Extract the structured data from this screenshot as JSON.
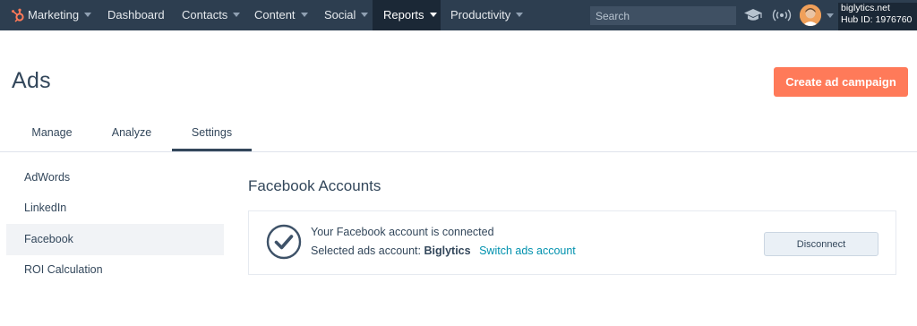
{
  "topnav": {
    "items": [
      {
        "label": "Marketing"
      },
      {
        "label": "Dashboard"
      },
      {
        "label": "Contacts"
      },
      {
        "label": "Content"
      },
      {
        "label": "Social"
      },
      {
        "label": "Reports"
      },
      {
        "label": "Productivity"
      }
    ],
    "active": "Reports",
    "search_placeholder": "Search",
    "account_domain": "biglytics.net",
    "hub_id": "Hub ID: 1976760",
    "icons": [
      "hubspot-logo-icon",
      "academy-icon",
      "broadcast-icon",
      "avatar",
      "chevron-down-icon"
    ]
  },
  "header": {
    "title": "Ads",
    "create_button": "Create ad campaign"
  },
  "tabs": [
    {
      "label": "Manage"
    },
    {
      "label": "Analyze"
    },
    {
      "label": "Settings"
    }
  ],
  "active_tab": "Settings",
  "sidebar": {
    "items": [
      {
        "label": "AdWords"
      },
      {
        "label": "LinkedIn"
      },
      {
        "label": "Facebook"
      },
      {
        "label": "ROI Calculation"
      }
    ],
    "active": "Facebook"
  },
  "content": {
    "section_title": "Facebook Accounts",
    "status_text": "Your Facebook account is connected",
    "selected_prefix": "Selected ads account:",
    "account_name": "Biglytics",
    "switch_link": "Switch ads account",
    "disconnect_button": "Disconnect"
  },
  "colors": {
    "nav_bg": "#2d3e50",
    "accent_orange": "#ff7a59",
    "link_teal": "#0091ae",
    "text_dark": "#33475b"
  }
}
